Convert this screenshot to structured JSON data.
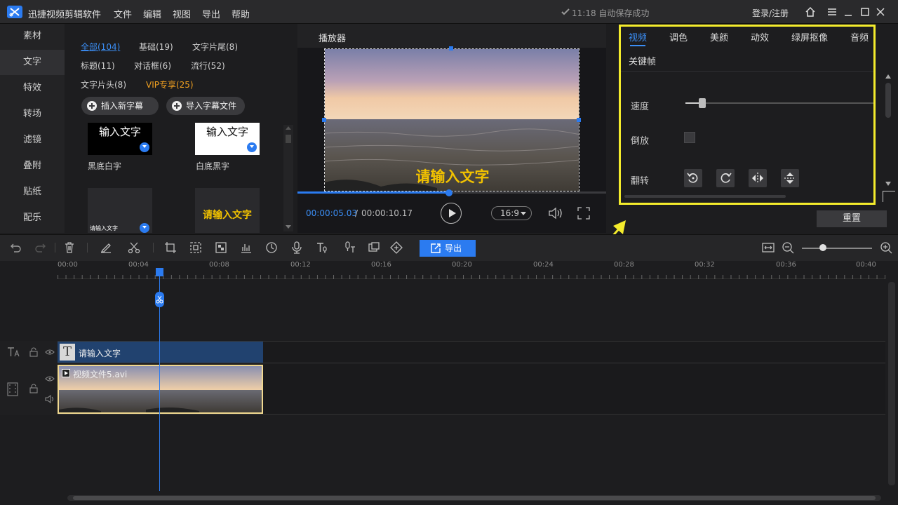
{
  "app": {
    "name": "迅捷视频剪辑软件"
  },
  "menu": [
    "文件",
    "编辑",
    "视图",
    "导出",
    "帮助"
  ],
  "status": {
    "autosave": "11:18 自动保存成功",
    "login": "登录/注册"
  },
  "categories": [
    "素材",
    "文字",
    "特效",
    "转场",
    "滤镜",
    "叠附",
    "贴纸",
    "配乐"
  ],
  "library": {
    "filters": [
      "全部(104)",
      "基础(19)",
      "文字片尾(8)",
      "标题(11)",
      "对话框(6)",
      "流行(52)",
      "文字片头(8)",
      "VIP专享(25)"
    ],
    "insert_subtitle": "插入新字幕",
    "import_subtitle": "导入字幕文件",
    "items": [
      {
        "preview": "输入文字",
        "label": "黑底白字"
      },
      {
        "preview": "输入文字",
        "label": "白底黑字"
      },
      {
        "preview": "请输入文字",
        "label": ""
      },
      {
        "preview": "请输入文字",
        "label": ""
      }
    ]
  },
  "player": {
    "title": "播放器",
    "overlay_text": "请输入文字",
    "current_time": "00:00:05.03",
    "separator": "/",
    "total_time": "00:00:10.17",
    "ratio": "16:9",
    "progress": 0.49
  },
  "properties": {
    "tabs": [
      "视频",
      "调色",
      "美颜",
      "动效",
      "绿屏抠像",
      "音频"
    ],
    "keyframe_tab": "关键帧",
    "speed_label": "速度",
    "reverse_label": "倒放",
    "flip_label": "翻转",
    "reset": "重置"
  },
  "toolbar": {
    "export": "导出",
    "zoom": 0.3
  },
  "timeline": {
    "ticks": [
      "00:00",
      "00:04",
      "00:08",
      "00:12",
      "00:16",
      "00:20",
      "00:24",
      "00:28",
      "00:32",
      "00:36",
      "00:40"
    ],
    "text_clip": "请输入文字",
    "video_clip": "视频文件5.avi"
  },
  "colors": {
    "accent": "#2b7bf0",
    "highlight_box": "#f4ec2c",
    "vip": "#f0a020",
    "overlay_text": "#f2c200"
  }
}
